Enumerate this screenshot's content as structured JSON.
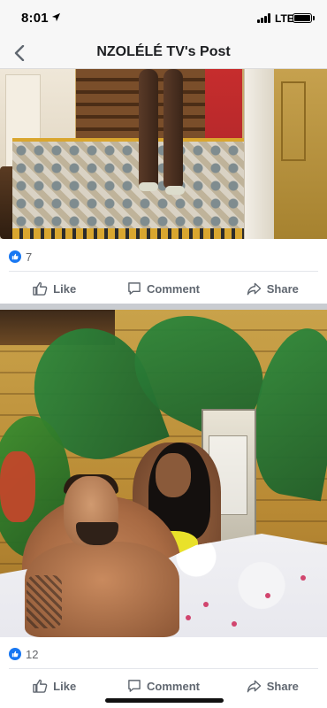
{
  "status_bar": {
    "time": "8:01",
    "network": "LTE"
  },
  "nav": {
    "title": "NZOLÉLÉ TV's Post",
    "back_icon": "chevron-left-icon"
  },
  "posts": [
    {
      "reaction_count": "7",
      "actions": {
        "like": "Like",
        "comment": "Comment",
        "share": "Share"
      }
    },
    {
      "reaction_count": "12",
      "actions": {
        "like": "Like",
        "comment": "Comment",
        "share": "Share"
      }
    }
  ],
  "colors": {
    "accent": "#1877f2",
    "action_text": "#606770",
    "separator": "#c9ccd1"
  }
}
